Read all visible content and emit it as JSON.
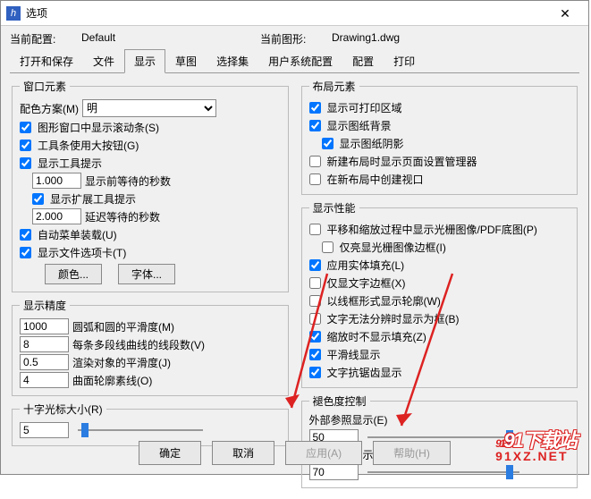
{
  "title": "选项",
  "close_glyph": "✕",
  "info": {
    "cfg_label": "当前配置:",
    "cfg_value": "Default",
    "dwg_label": "当前图形:",
    "dwg_value": "Drawing1.dwg"
  },
  "tabs": [
    "打开和保存",
    "文件",
    "显示",
    "草图",
    "选择集",
    "用户系统配置",
    "配置",
    "打印"
  ],
  "window_elem": {
    "legend": "窗口元素",
    "scheme_label": "配色方案(M)",
    "scheme_value": "明",
    "cb_scroll": "图形窗口中显示滚动条(S)",
    "cb_bigbtn": "工具条使用大按钮(G)",
    "cb_tooltip": "显示工具提示",
    "sec1_val": "1.000",
    "sec1_lbl": "显示前等待的秒数",
    "cb_exttip": "显示扩展工具提示",
    "sec2_val": "2.000",
    "sec2_lbl": "延迟等待的秒数",
    "cb_automenu": "自动菜单装载(U)",
    "cb_tabfile": "显示文件选项卡(T)",
    "btn_color": "颜色...",
    "btn_font": "字体..."
  },
  "precision": {
    "legend": "显示精度",
    "v1": "1000",
    "l1": "圆弧和圆的平滑度(M)",
    "v2": "8",
    "l2": "每条多段线曲线的线段数(V)",
    "v3": "0.5",
    "l3": "渲染对象的平滑度(J)",
    "v4": "4",
    "l4": "曲面轮廓素线(O)"
  },
  "cross": {
    "legend": "十字光标大小(R)",
    "val": "5"
  },
  "layout": {
    "legend": "布局元素",
    "cb_print": "显示可打印区域",
    "cb_paper": "显示图纸背景",
    "cb_shadow": "显示图纸阴影",
    "cb_newlayout": "新建布局时显示页面设置管理器",
    "cb_viewport": "在新布局中创建视口"
  },
  "perf": {
    "legend": "显示性能",
    "cb_raster": "平移和缩放过程中显示光栅图像/PDF底图(P)",
    "cb_highlight": "仅亮显光栅图像边框(I)",
    "cb_solidfill": "应用实体填充(L)",
    "cb_txtborder": "仅显文字边框(X)",
    "cb_wireframe": "以线框形式显示轮廓(W)",
    "cb_nofontbox": "文字无法分辨时显示为框(B)",
    "cb_zoomfill": "缩放时不显示填充(Z)",
    "cb_smoothline": "平滑线显示",
    "cb_antialias": "文字抗锯齿显示"
  },
  "fade": {
    "legend": "褪色度控制",
    "ext_lbl": "外部参照显示(E)",
    "ext_val": "50",
    "inp_lbl": "在位编辑显示(Y)",
    "inp_val": "70"
  },
  "bottom": {
    "ok": "确定",
    "cancel": "取消",
    "apply": "应用(A)",
    "help": "帮助(H)"
  },
  "watermark": {
    "top": "91下载站",
    "bottom": "91XZ.NET"
  }
}
